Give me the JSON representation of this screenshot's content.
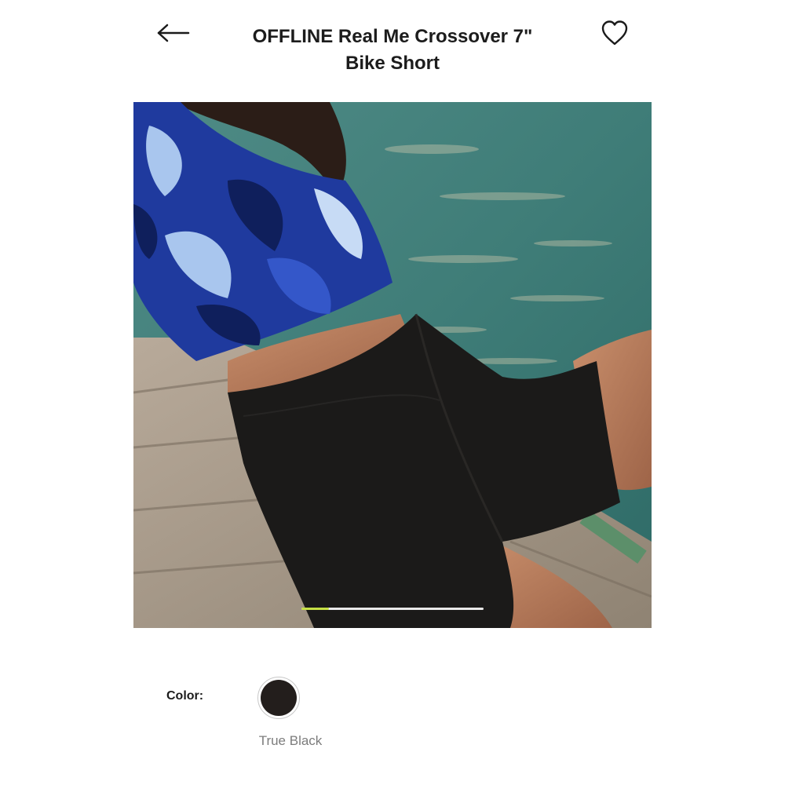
{
  "header": {
    "title_line1": "OFFLINE Real Me Crossover 7\"",
    "title_line2": "Bike Short",
    "back_icon": "arrow-left-icon",
    "favorite_icon": "heart-outline-icon"
  },
  "gallery": {
    "image_alt": "Model sitting on a wooden dock by the water wearing a blue floral crop top and black bike shorts",
    "carousel_progress": 0.15,
    "carousel_fill_color": "#c6e045"
  },
  "product": {
    "color_label": "Color:",
    "selected_color_name": "True Black",
    "selected_color_hex": "#231e1c"
  }
}
